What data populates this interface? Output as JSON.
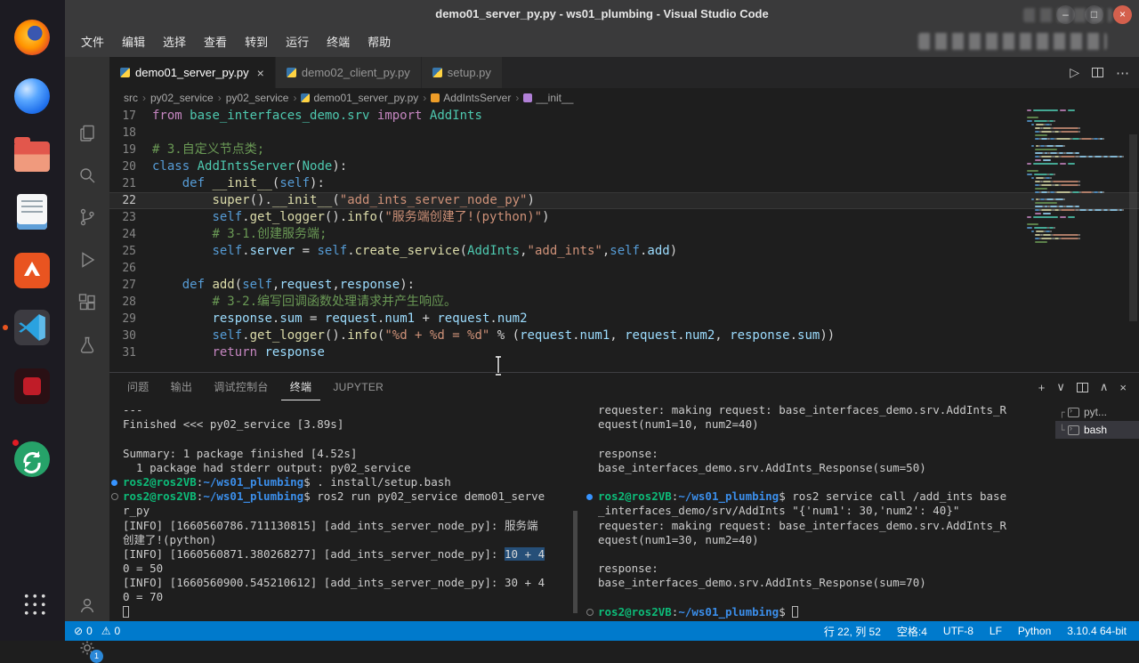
{
  "window": {
    "title": "demo01_server_py.py - ws01_plumbing - Visual Studio Code"
  },
  "icons": {
    "min": "–",
    "max": "□",
    "close": "×",
    "run": "▷",
    "more": "⋯",
    "sep": "›",
    "plus": "+",
    "chev_down": "∨",
    "chev_up": "∧"
  },
  "menubar": [
    "文件",
    "编辑",
    "选择",
    "查看",
    "转到",
    "运行",
    "终端",
    "帮助"
  ],
  "dock_apps": [
    "firefox",
    "browser",
    "files",
    "text-editor",
    "ubuntu-software",
    "vscode",
    "dark-red-app",
    "software-updater",
    "app-grid"
  ],
  "activitybar": {
    "items": [
      "explorer",
      "search",
      "source-control",
      "run-debug",
      "extensions",
      "testing"
    ],
    "bottom": [
      "accounts",
      "manage"
    ],
    "manage_badge": "1"
  },
  "tabs": [
    {
      "label": "demo01_server_py.py",
      "icon": "python",
      "active": true
    },
    {
      "label": "demo02_client_py.py",
      "icon": "python",
      "active": false
    },
    {
      "label": "setup.py",
      "icon": "python",
      "active": false
    }
  ],
  "breadcrumb": [
    {
      "label": "src"
    },
    {
      "label": "py02_service"
    },
    {
      "label": "py02_service"
    },
    {
      "label": "demo01_server_py.py",
      "icon": "python"
    },
    {
      "label": "AddIntsServer",
      "icon": "class"
    },
    {
      "label": "__init__",
      "icon": "method"
    }
  ],
  "editor": {
    "lines": [
      {
        "num": 17,
        "tokens": [
          [
            "k1",
            "from"
          ],
          [
            "pl",
            " "
          ],
          [
            "cl",
            "base_interfaces_demo.srv"
          ],
          [
            "pl",
            " "
          ],
          [
            "k1",
            "import"
          ],
          [
            "pl",
            " "
          ],
          [
            "cl",
            "AddInts"
          ]
        ]
      },
      {
        "num": 18,
        "tokens": []
      },
      {
        "num": 19,
        "tokens": [
          [
            "cm",
            "# 3.自定义节点类;"
          ]
        ]
      },
      {
        "num": 20,
        "tokens": [
          [
            "k2",
            "class"
          ],
          [
            "pl",
            " "
          ],
          [
            "cl",
            "AddIntsServer"
          ],
          [
            "pl",
            "("
          ],
          [
            "cl",
            "Node"
          ],
          [
            "pl",
            "):"
          ]
        ]
      },
      {
        "num": 21,
        "tokens": [
          [
            "pl",
            "    "
          ],
          [
            "k2",
            "def"
          ],
          [
            "pl",
            " "
          ],
          [
            "fn",
            "__init__"
          ],
          [
            "pl",
            "("
          ],
          [
            "k2",
            "self"
          ],
          [
            "pl",
            "):"
          ]
        ]
      },
      {
        "num": 22,
        "cur": true,
        "tokens": [
          [
            "pl",
            "        "
          ],
          [
            "fn",
            "super"
          ],
          [
            "pl",
            "()."
          ],
          [
            "fn",
            "__init__"
          ],
          [
            "pl",
            "("
          ],
          [
            "st",
            "\"add_ints_server_node_py\""
          ],
          [
            "pl",
            ")"
          ]
        ]
      },
      {
        "num": 23,
        "tokens": [
          [
            "pl",
            "        "
          ],
          [
            "k2",
            "self"
          ],
          [
            "pl",
            "."
          ],
          [
            "fn",
            "get_logger"
          ],
          [
            "pl",
            "()."
          ],
          [
            "fn",
            "info"
          ],
          [
            "pl",
            "("
          ],
          [
            "st",
            "\"服务端创建了!(python)\""
          ],
          [
            "pl",
            ")"
          ]
        ]
      },
      {
        "num": 24,
        "tokens": [
          [
            "pl",
            "        "
          ],
          [
            "cm",
            "# 3-1.创建服务端;"
          ]
        ]
      },
      {
        "num": 25,
        "tokens": [
          [
            "pl",
            "        "
          ],
          [
            "k2",
            "self"
          ],
          [
            "pl",
            "."
          ],
          [
            "vr",
            "server"
          ],
          [
            "pl",
            " = "
          ],
          [
            "k2",
            "self"
          ],
          [
            "pl",
            "."
          ],
          [
            "fn",
            "create_service"
          ],
          [
            "pl",
            "("
          ],
          [
            "cl",
            "AddInts"
          ],
          [
            "pl",
            ","
          ],
          [
            "st",
            "\"add_ints\""
          ],
          [
            "pl",
            ","
          ],
          [
            "k2",
            "self"
          ],
          [
            "pl",
            "."
          ],
          [
            "vr",
            "add"
          ],
          [
            "pl",
            ")"
          ]
        ]
      },
      {
        "num": 26,
        "tokens": []
      },
      {
        "num": 27,
        "tokens": [
          [
            "pl",
            "    "
          ],
          [
            "k2",
            "def"
          ],
          [
            "pl",
            " "
          ],
          [
            "fn",
            "add"
          ],
          [
            "pl",
            "("
          ],
          [
            "k2",
            "self"
          ],
          [
            "pl",
            ","
          ],
          [
            "vr",
            "request"
          ],
          [
            "pl",
            ","
          ],
          [
            "vr",
            "response"
          ],
          [
            "pl",
            "):"
          ]
        ]
      },
      {
        "num": 28,
        "tokens": [
          [
            "pl",
            "        "
          ],
          [
            "cm",
            "# 3-2.编写回调函数处理请求并产生响应。"
          ]
        ]
      },
      {
        "num": 29,
        "tokens": [
          [
            "pl",
            "        "
          ],
          [
            "vr",
            "response"
          ],
          [
            "pl",
            "."
          ],
          [
            "vr",
            "sum"
          ],
          [
            "pl",
            " = "
          ],
          [
            "vr",
            "request"
          ],
          [
            "pl",
            "."
          ],
          [
            "vr",
            "num1"
          ],
          [
            "pl",
            " + "
          ],
          [
            "vr",
            "request"
          ],
          [
            "pl",
            "."
          ],
          [
            "vr",
            "num2"
          ]
        ]
      },
      {
        "num": 30,
        "tokens": [
          [
            "pl",
            "        "
          ],
          [
            "k2",
            "self"
          ],
          [
            "pl",
            "."
          ],
          [
            "fn",
            "get_logger"
          ],
          [
            "pl",
            "()."
          ],
          [
            "fn",
            "info"
          ],
          [
            "pl",
            "("
          ],
          [
            "st",
            "\"%d + %d = %d\""
          ],
          [
            "pl",
            " % ("
          ],
          [
            "vr",
            "request"
          ],
          [
            "pl",
            "."
          ],
          [
            "vr",
            "num1"
          ],
          [
            "pl",
            ", "
          ],
          [
            "vr",
            "request"
          ],
          [
            "pl",
            "."
          ],
          [
            "vr",
            "num2"
          ],
          [
            "pl",
            ", "
          ],
          [
            "vr",
            "response"
          ],
          [
            "pl",
            "."
          ],
          [
            "vr",
            "sum"
          ],
          [
            "pl",
            "))"
          ]
        ]
      },
      {
        "num": 31,
        "tokens": [
          [
            "pl",
            "        "
          ],
          [
            "k1",
            "return"
          ],
          [
            "pl",
            " "
          ],
          [
            "vr",
            "response"
          ]
        ]
      }
    ]
  },
  "panel": {
    "tabs": [
      {
        "label": "问题",
        "active": false
      },
      {
        "label": "输出",
        "active": false
      },
      {
        "label": "调试控制台",
        "active": false
      },
      {
        "label": "终端",
        "active": true
      },
      {
        "label": "JUPYTER",
        "active": false
      }
    ]
  },
  "terminal_left": {
    "lines": [
      {
        "t": [
          [
            "tp",
            "---"
          ]
        ]
      },
      {
        "t": [
          [
            "tp",
            "Finished <<< py02_service [3.89s]"
          ]
        ]
      },
      {
        "t": []
      },
      {
        "t": [
          [
            "tp",
            "Summary: 1 package finished [4.52s]"
          ]
        ]
      },
      {
        "t": [
          [
            "tp",
            "  1 package had stderr output: py02_service"
          ]
        ]
      },
      {
        "dec": "blue",
        "t": [
          [
            "tg",
            "ros2@ros2VB"
          ],
          [
            "tp",
            ":"
          ],
          [
            "tb",
            "~/ws01_plumbing"
          ],
          [
            "tp",
            "$ . install/setup.bash"
          ]
        ]
      },
      {
        "dec": "gray",
        "t": [
          [
            "tg",
            "ros2@ros2VB"
          ],
          [
            "tp",
            ":"
          ],
          [
            "tb",
            "~/ws01_plumbing"
          ],
          [
            "tp",
            "$ ros2 run py02_service demo01_serve"
          ]
        ]
      },
      {
        "t": [
          [
            "tp",
            "r_py"
          ]
        ]
      },
      {
        "t": [
          [
            "tp",
            "[INFO] [1660560786.711130815] [add_ints_server_node_py]: 服务端"
          ]
        ]
      },
      {
        "t": [
          [
            "tp",
            "创建了!(python)"
          ]
        ]
      },
      {
        "t": [
          [
            "tp",
            "[INFO] [1660560871.380268277] [add_ints_server_node_py]: "
          ],
          [
            "sel",
            "10 + 4"
          ]
        ]
      },
      {
        "t": [
          [
            "tp",
            "0 = 50"
          ]
        ]
      },
      {
        "t": [
          [
            "tp",
            "[INFO] [1660560900.545210612] [add_ints_server_node_py]: 30 + 4"
          ]
        ]
      },
      {
        "t": [
          [
            "tp",
            "0 = 70"
          ]
        ]
      },
      {
        "t": [],
        "cursor": "hollow"
      }
    ]
  },
  "terminal_right": {
    "lines": [
      {
        "t": [
          [
            "tp",
            "requester: making request: base_interfaces_demo.srv.AddInts_R"
          ]
        ]
      },
      {
        "t": [
          [
            "tp",
            "equest(num1=10, num2=40)"
          ]
        ]
      },
      {
        "t": []
      },
      {
        "t": [
          [
            "tp",
            "response:"
          ]
        ]
      },
      {
        "t": [
          [
            "tp",
            "base_interfaces_demo.srv.AddInts_Response(sum=50)"
          ]
        ]
      },
      {
        "t": []
      },
      {
        "dec": "blue",
        "t": [
          [
            "tg",
            "ros2@ros2VB"
          ],
          [
            "tp",
            ":"
          ],
          [
            "tb",
            "~/ws01_plumbing"
          ],
          [
            "tp",
            "$ ros2 service call /add_ints base"
          ]
        ]
      },
      {
        "t": [
          [
            "tp",
            "_interfaces_demo/srv/AddInts \"{'num1': 30,'num2': 40}\""
          ]
        ]
      },
      {
        "t": [
          [
            "tp",
            "requester: making request: base_interfaces_demo.srv.AddInts_R"
          ]
        ]
      },
      {
        "t": [
          [
            "tp",
            "equest(num1=30, num2=40)"
          ]
        ]
      },
      {
        "t": []
      },
      {
        "t": [
          [
            "tp",
            "response:"
          ]
        ]
      },
      {
        "t": [
          [
            "tp",
            "base_interfaces_demo.srv.AddInts_Response(sum=70)"
          ]
        ]
      },
      {
        "t": []
      },
      {
        "dec": "gray",
        "t": [
          [
            "tg",
            "ros2@ros2VB"
          ],
          [
            "tp",
            ":"
          ],
          [
            "tb",
            "~/ws01_plumbing"
          ],
          [
            "tp",
            "$ "
          ]
        ],
        "cursor": "hollow"
      }
    ]
  },
  "terminal_list": {
    "items": [
      {
        "tree": "┌",
        "label": "pyt...",
        "selected": false
      },
      {
        "tree": "└",
        "label": "bash",
        "selected": true
      }
    ]
  },
  "statusbar": {
    "left": [
      {
        "name": "errors",
        "glyph": "⊘",
        "value": "0"
      },
      {
        "name": "warnings",
        "glyph": "⚠",
        "value": "0"
      }
    ],
    "right": [
      {
        "name": "cursor-position",
        "label": "行 22, 列 52"
      },
      {
        "name": "indentation",
        "label": "空格:4"
      },
      {
        "name": "encoding",
        "label": "UTF-8"
      },
      {
        "name": "eol",
        "label": "LF"
      },
      {
        "name": "language",
        "label": "Python"
      },
      {
        "name": "interpreter",
        "label": "3.10.4 64-bit"
      }
    ]
  }
}
